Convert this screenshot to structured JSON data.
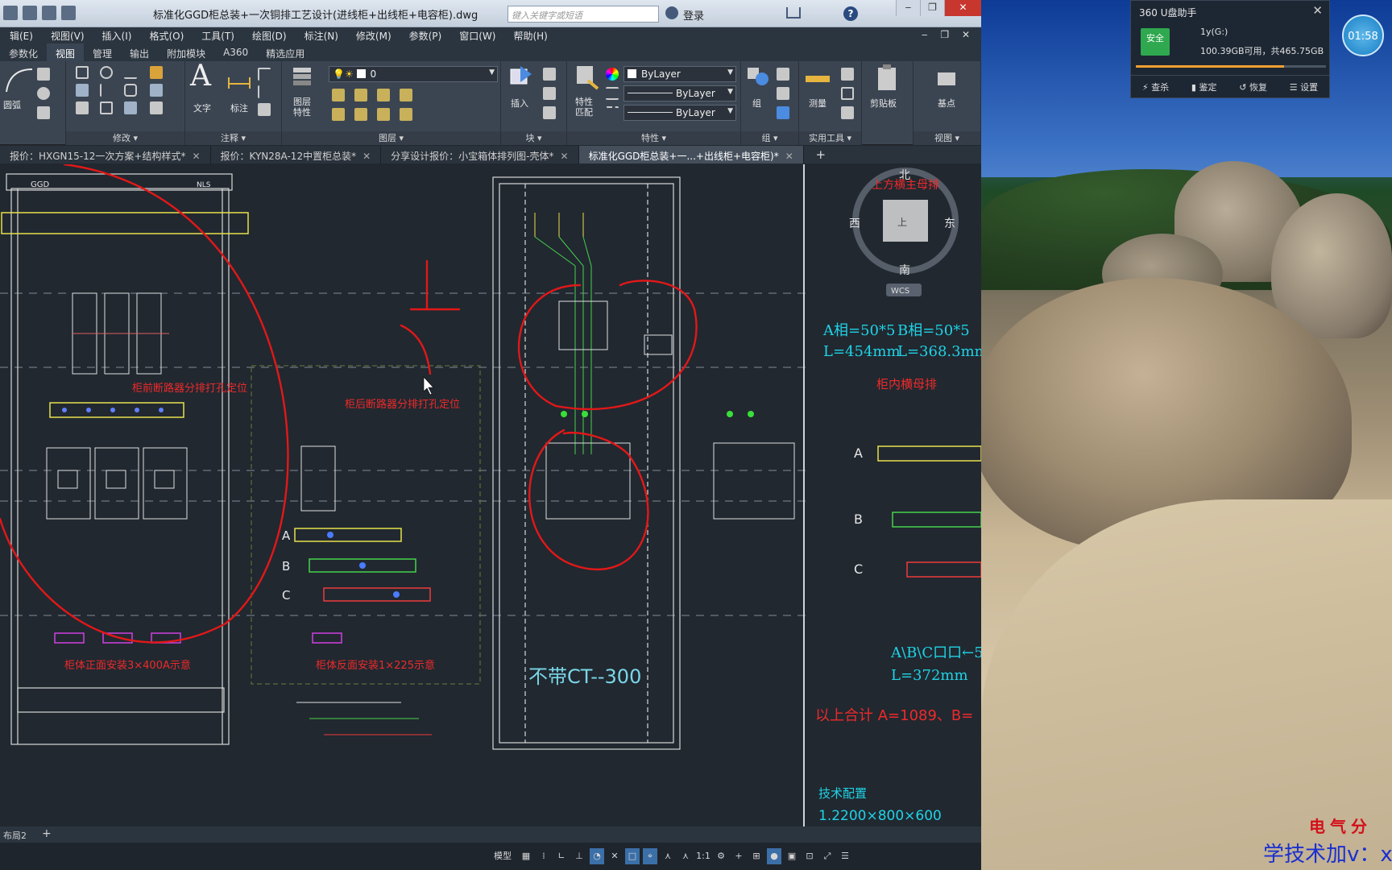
{
  "app": {
    "title": "标准化GGD柜总装+一次铜排工艺设计(进线柜+出线柜+电容柜).dwg",
    "search_placeholder": "键入关键字或短语",
    "login_label": "登录"
  },
  "menu": [
    "辑(E)",
    "视图(V)",
    "插入(I)",
    "格式(O)",
    "工具(T)",
    "绘图(D)",
    "标注(N)",
    "修改(M)",
    "参数(P)",
    "窗口(W)",
    "帮助(H)"
  ],
  "ribbon_tabs": [
    "参数化",
    "视图",
    "管理",
    "输出",
    "附加模块",
    "A360",
    "精选应用"
  ],
  "ribbon": {
    "modify_title": "修改 ▾",
    "annotation_title": "注释 ▾",
    "layers_title": "图层 ▾",
    "block_title": "块 ▾",
    "properties_title": "特性 ▾",
    "groups_title": "组 ▾",
    "utilities_title": "实用工具 ▾",
    "view_title": "视图 ▾",
    "arc_label": "圆弧",
    "text_label": "文字",
    "dim_label": "标注",
    "layer_props_label": "图层\n特性",
    "insert_label": "插入",
    "match_label": "特性\n匹配",
    "group_label": "组",
    "measure_label": "测量",
    "clipboard_label": "剪贴板",
    "base_label": "基点",
    "layer_combo": "0",
    "color_combo": "ByLayer",
    "linetype_combo": "ByLayer",
    "lineweight_combo": "ByLayer"
  },
  "doc_tabs": [
    {
      "label": "报价：HXGN15-12一次方案+结构样式*",
      "active": false
    },
    {
      "label": "报价：KYN28A-12中置柜总装*",
      "active": false
    },
    {
      "label": "分享设计报价：小宝箱体排列图-壳体*",
      "active": false
    },
    {
      "label": "标准化GGD柜总装+一...+出线柜+电容柜)*",
      "active": true
    }
  ],
  "layout_tab": "布局2",
  "status": {
    "model_label": "模型",
    "scale_label": "1:1"
  },
  "drawing_text": {
    "ggd": "GGD",
    "nls": "NLS",
    "front_breaker_note": "柜前断路器分排打孔定位",
    "rear_breaker_note": "柜后断路器分排打孔定位",
    "front_mount_note": "柜体正面安装3×400A示意",
    "rear_mount_note": "柜体反面安装1×225示意",
    "no_ct": "不带CT--300",
    "phase_a": "A",
    "phase_b": "B",
    "phase_c": "C",
    "dim_a": "A相=50*5",
    "dim_b": "B相=50*5",
    "len_a": "L=454mm",
    "len_b": "L=368.3mm",
    "inner_bus": "柜内横母排",
    "abc_label": "A\\B\\C口口←5",
    "len_c": "L=372mm",
    "total": "以上合计 A=1089、B=",
    "tech_config": "技术配置",
    "dimensions": "1.2200×800×600",
    "top_busbar": "上方横主母排",
    "north": "北",
    "south": "南",
    "east": "东",
    "west": "西",
    "viewcube_top": "上",
    "wcs": "WCS"
  },
  "u_helper": {
    "title": "360 U盘助手",
    "badge": "安全",
    "drive": "1y(G:)",
    "space": "100.39GB可用，共465.75GB",
    "usage_fraction": 0.78,
    "actions": [
      "查杀",
      "鉴定",
      "恢复",
      "设置"
    ]
  },
  "clock": "01:58",
  "watermark": {
    "line1": "电气分",
    "line2": "学技术加v：x"
  }
}
